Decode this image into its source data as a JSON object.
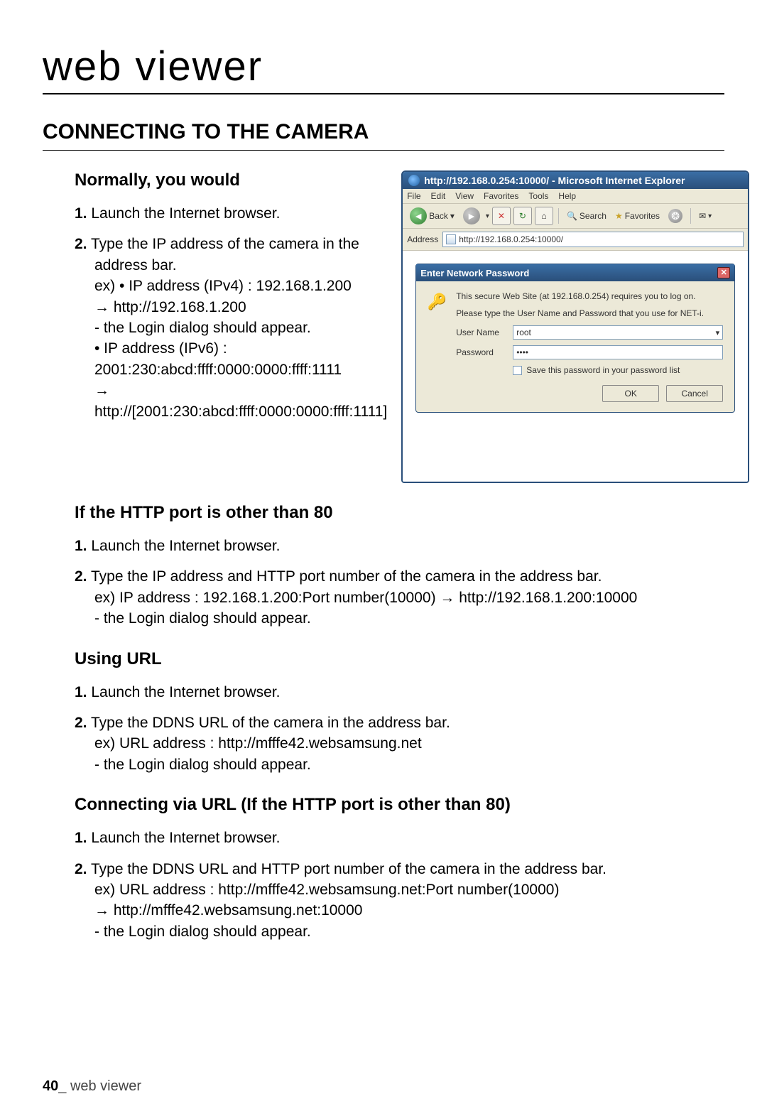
{
  "page_title": "web viewer",
  "section_heading": "CONNECTING TO THE CAMERA",
  "sec_normally": {
    "heading": "Normally, you would",
    "step1_num": "1.",
    "step1_text": " Launch the Internet browser.",
    "step2_num": "2.",
    "step2_text": " Type the IP address of the camera in the address bar.",
    "step2_l1": "ex) • IP address (IPv4) : 192.168.1.200",
    "step2_l2": "→ http://192.168.1.200",
    "step2_l3": "- the Login dialog should appear.",
    "step2_l4": "• IP address (IPv6) : 2001:230:abcd:ffff:0000:0000:ffff:1111",
    "step2_l5": "→ http://[2001:230:abcd:ffff:0000:0000:ffff:1111]"
  },
  "sec_port": {
    "heading": "If the HTTP port is other than 80",
    "step1_num": "1.",
    "step1_text": " Launch the Internet browser.",
    "step2_num": "2.",
    "step2_text": " Type the IP address and HTTP port number of the camera in the address bar.",
    "step2_l1": "ex) IP address : 192.168.1.200:Port number(10000) → http://192.168.1.200:10000",
    "step2_l2": "- the Login dialog should appear."
  },
  "sec_url": {
    "heading": "Using URL",
    "step1_num": "1.",
    "step1_text": " Launch the Internet browser.",
    "step2_num": "2.",
    "step2_text": " Type the DDNS URL of the camera in the address bar.",
    "step2_l1": "ex) URL address : http://mfffe42.websamsung.net",
    "step2_l2": "- the Login dialog should appear."
  },
  "sec_url_port": {
    "heading": "Connecting via URL (If the HTTP port is other than 80)",
    "step1_num": "1.",
    "step1_text": " Launch the Internet browser.",
    "step2_num": "2.",
    "step2_text": " Type the DDNS URL and HTTP port number of the camera in the address bar.",
    "step2_l1": "ex) URL address : http://mfffe42.websamsung.net:Port number(10000)",
    "step2_l2": "→ http://mfffe42.websamsung.net:10000",
    "step2_l3": "- the Login dialog should appear."
  },
  "browser": {
    "title": "http://192.168.0.254:10000/ - Microsoft Internet Explorer",
    "menu": {
      "file": "File",
      "edit": "Edit",
      "view": "View",
      "favorites": "Favorites",
      "tools": "Tools",
      "help": "Help"
    },
    "back_label": "Back",
    "search_label": "Search",
    "favorites_label": "Favorites",
    "address_label": "Address",
    "address_value": "http://192.168.0.254:10000/"
  },
  "dialog": {
    "title": "Enter Network Password",
    "line1": "This secure Web Site (at 192.168.0.254) requires you to log on.",
    "line2": "Please type the User Name and Password that you use for NET-i.",
    "username_label": "User Name",
    "username_value": "root",
    "password_label": "Password",
    "password_value": "••••",
    "save_label": "Save this password in your password list",
    "ok": "OK",
    "cancel": "Cancel"
  },
  "footer": {
    "page": "40",
    "sep": "_ ",
    "label": "web viewer"
  }
}
